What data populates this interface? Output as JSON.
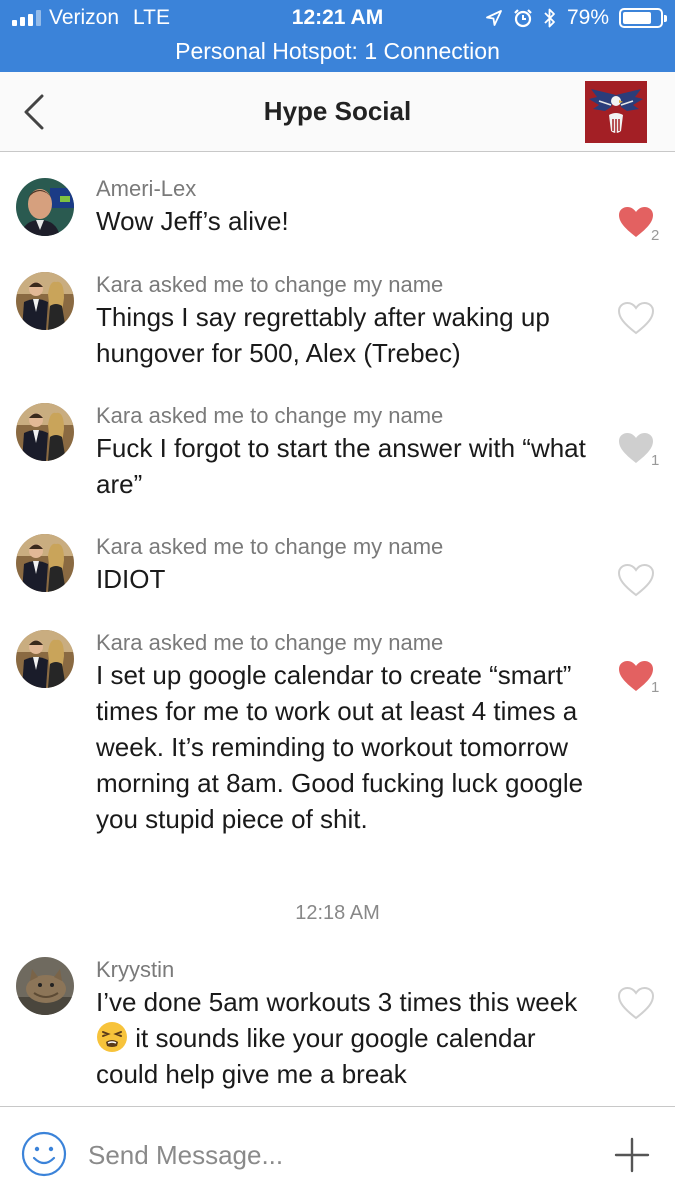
{
  "status_bar": {
    "carrier": "Verizon",
    "network": "LTE",
    "time": "12:21 AM",
    "battery": "79%",
    "battery_level": 0.79,
    "hotspot": "Personal Hotspot: 1 Connection"
  },
  "header": {
    "title": "Hype Social",
    "back_icon": "chevron-left-icon",
    "group_avatar_icon": "eagle-logo-icon"
  },
  "messages": [
    {
      "sender": "Ameri-Lex",
      "text": "Wow Jeff’s alive!",
      "liked": true,
      "likes": "2"
    },
    {
      "sender": "Kara asked me to change my name",
      "text": "Things I say regrettably after waking up hungover for 500, Alex (Trebec)",
      "liked": false,
      "likes": ""
    },
    {
      "sender": "Kara asked me to change my name",
      "text": "Fuck I forgot to start the answer with “what are”",
      "liked": false,
      "likes": "1"
    },
    {
      "sender": "Kara asked me to change my name",
      "text": "IDIOT",
      "liked": false,
      "likes": ""
    },
    {
      "sender": "Kara asked me to change my name",
      "text": "I set up google calendar to create “smart” times for me to work out at least 4 times a week. It’s reminding to workout tomorrow morning at 8am. Good fucking luck google you stupid piece of shit.",
      "liked": true,
      "likes": "1"
    },
    {
      "sender": "Kryystin",
      "text_before": "I’ve done 5am workouts 3 times this week",
      "text_after": "it sounds like your google calendar could help give me a break",
      "liked": false,
      "likes": ""
    }
  ],
  "timestamp": "12:18 AM",
  "composer": {
    "placeholder": "Send Message...",
    "emoji_icon": "smiley-icon",
    "add_icon": "plus-icon"
  },
  "colors": {
    "status_bar": "#3b83d9",
    "heart_liked": "#e36161",
    "heart_liked_grey": "#cfcfcf",
    "heart_outline": "#d0d0d0"
  }
}
